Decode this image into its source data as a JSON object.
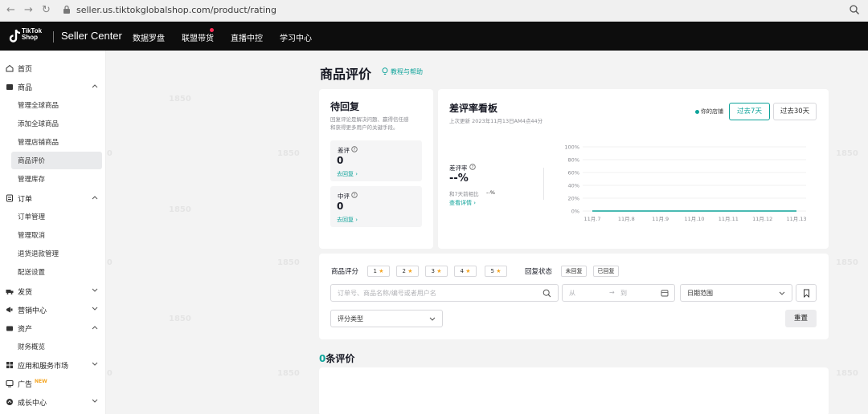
{
  "browser": {
    "back": "←",
    "forward": "→",
    "reload": "↻",
    "url": "seller.us.tiktokglobalshop.com/product/rating"
  },
  "topnav": {
    "logo_line1": "TikTok",
    "logo_line2": "Shop",
    "brand": "Seller Center",
    "menu": [
      "数据罗盘",
      "联盟带货",
      "直播中控",
      "学习中心"
    ]
  },
  "sidebar": {
    "home": "首页",
    "product": "商品",
    "product_items": [
      "管理全球商品",
      "添加全球商品",
      "管理店铺商品",
      "商品评价",
      "管理库存"
    ],
    "order": "订单",
    "order_items": [
      "订单管理",
      "管理取消",
      "退货退款管理",
      "配送设置"
    ],
    "shipping": "发货",
    "marketing": "营销中心",
    "assets": "资产",
    "assets_items": [
      "财务概览"
    ],
    "apps": "应用和服务市场",
    "ads": "广告",
    "ads_badge": "NEW",
    "growth": "成长中心"
  },
  "page": {
    "title": "商品评价",
    "help": "教程与帮助"
  },
  "pending": {
    "title": "待回复",
    "desc_line1": "回复评论是解决问题、赢得信任感",
    "desc_line2": "和获得更多用户的关键手段。",
    "negative_label": "差评",
    "negative_value": "0",
    "neutral_label": "中评",
    "neutral_value": "0",
    "reply_link": "去回复 ›"
  },
  "dashboard": {
    "title": "差评率看板",
    "updated": "上次更新 2023年11月13日AM4点44分",
    "legend": "你的店铺",
    "tab_7": "过去7天",
    "tab_30": "过去30天",
    "rate_label": "差评率",
    "rate_value": "--%",
    "compare_label": "和7天前相比",
    "compare_value": "--%",
    "details_link": "查看详情 ›"
  },
  "chart_data": {
    "type": "line",
    "categories": [
      "11月.7",
      "11月.8",
      "11月.9",
      "11月.10",
      "11月.11",
      "11月.12",
      "11月.13"
    ],
    "y_ticks": [
      "100%",
      "80%",
      "60%",
      "40%",
      "20%",
      "0%"
    ],
    "ylim": [
      0,
      100
    ],
    "series": [
      {
        "name": "你的店铺",
        "values": [
          0,
          0,
          0,
          0,
          0,
          0,
          0
        ],
        "color": "#0ea39a"
      }
    ],
    "grid": true
  },
  "filters": {
    "rating_label": "商品评分",
    "stars": [
      "1",
      "2",
      "3",
      "4",
      "5"
    ],
    "star_glyph": "★",
    "reply_status_label": "回复状态",
    "status_unreplied": "未回复",
    "status_replied": "已回复",
    "search_placeholder": "订单号、商品名称/编号或者用户名",
    "date_from": "从",
    "date_arrow": "→",
    "date_to": "到",
    "date_range": "日期范围",
    "rating_type": "评分类型",
    "reset": "重置"
  },
  "reviews": {
    "count": "0",
    "suffix": "条评价"
  },
  "watermark": "1850",
  "colors": {
    "accent": "#0ea39a",
    "topnav_bg": "#0d0d0d",
    "star": "#f5a623"
  }
}
